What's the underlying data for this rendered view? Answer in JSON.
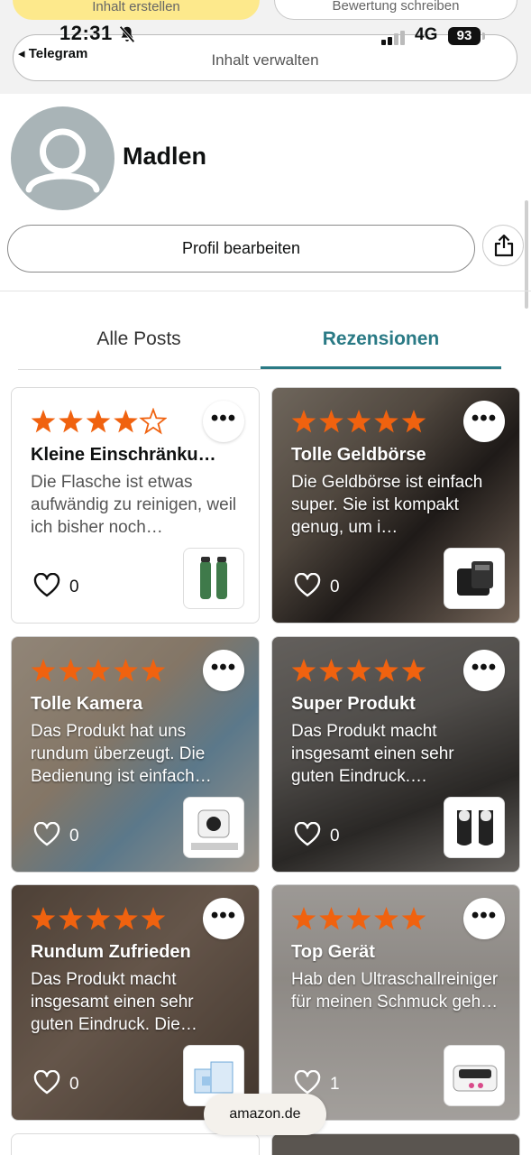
{
  "status_bar": {
    "time": "12:31",
    "back_app": "◂ Telegram",
    "network": "4G",
    "battery": "93"
  },
  "header": {
    "peek_left_label": "Inhalt erstellen",
    "peek_right_label": "Bewertung schreiben",
    "manage_button": "Inhalt verwalten"
  },
  "profile": {
    "name": "Madlen",
    "edit_button": "Profil bearbeiten"
  },
  "tabs": [
    {
      "label": "Alle Posts",
      "active": false
    },
    {
      "label": "Rezensionen",
      "active": true
    }
  ],
  "colors": {
    "accent": "#2a7a85",
    "star": "#f0620f"
  },
  "reviews": [
    {
      "title": "Kleine Einschränku…",
      "text": "Die Flasche ist etwas aufwändig zu reinigen, weil ich bisher noch…",
      "rating": 4,
      "likes": "0",
      "has_photo": false,
      "thumbnail_icon": "water-bottle-icon"
    },
    {
      "title": "Tolle Geldbörse",
      "text": "Die Geldbörse ist einfach super. Sie ist kompakt genug, um i…",
      "rating": 5,
      "likes": "0",
      "has_photo": true,
      "thumbnail_icon": "wallet-icon"
    },
    {
      "title": "Tolle Kamera",
      "text": "Das Produkt hat uns rundum überzeugt. Die Bedienung ist einfach…",
      "rating": 5,
      "likes": "0",
      "has_photo": true,
      "thumbnail_icon": "camera-icon"
    },
    {
      "title": "Super Produkt",
      "text": "Das Produkt macht insgesamt einen sehr guten Eindruck.…",
      "rating": 5,
      "likes": "0",
      "has_photo": true,
      "thumbnail_icon": "shin-guard-icon"
    },
    {
      "title": "Rundum Zufrieden",
      "text": "Das Produkt macht insgesamt einen sehr guten Eindruck. Die…",
      "rating": 5,
      "likes": "0",
      "has_photo": true,
      "thumbnail_icon": "vacuum-bag-icon"
    },
    {
      "title": "Top Gerät",
      "text": "Hab den Ultraschallreiniger für meinen Schmuck geh…",
      "rating": 5,
      "likes": "1",
      "has_photo": true,
      "thumbnail_icon": "ultrasonic-cleaner-icon"
    }
  ],
  "footer": {
    "domain": "amazon.de"
  }
}
